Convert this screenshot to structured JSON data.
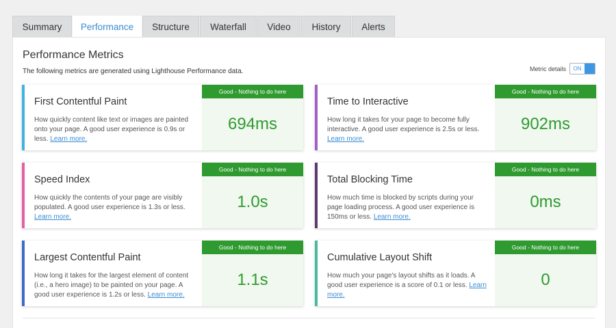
{
  "tabs": [
    {
      "label": "Summary",
      "active": false
    },
    {
      "label": "Performance",
      "active": true
    },
    {
      "label": "Structure",
      "active": false
    },
    {
      "label": "Waterfall",
      "active": false
    },
    {
      "label": "Video",
      "active": false
    },
    {
      "label": "History",
      "active": false
    },
    {
      "label": "Alerts",
      "active": false
    }
  ],
  "panel": {
    "title": "Performance Metrics",
    "description": "The following metrics are generated using Lighthouse Performance data.",
    "metric_details_label": "Metric details",
    "metric_details_state": "ON"
  },
  "colors": {
    "accent": "#3a8bd1",
    "good": "#2f9a2f",
    "good_bg": "#f0f8ef"
  },
  "metrics": [
    {
      "title": "First Contentful Paint",
      "description": "How quickly content like text or images are painted onto your page. A good user experience is 0.9s or less.",
      "learn_more": "Learn more.",
      "badge": "Good - Nothing to do here",
      "value": "694ms",
      "color": "#3fb5de"
    },
    {
      "title": "Time to Interactive",
      "description": "How long it takes for your page to become fully interactive. A good user experience is 2.5s or less.",
      "learn_more": "Learn more.",
      "badge": "Good - Nothing to do here",
      "value": "902ms",
      "color": "#a461c4"
    },
    {
      "title": "Speed Index",
      "description": "How quickly the contents of your page are visibly populated. A good user experience is 1.3s or less.",
      "learn_more": "Learn more.",
      "badge": "Good - Nothing to do here",
      "value": "1.0s",
      "color": "#e561a6"
    },
    {
      "title": "Total Blocking Time",
      "description": "How much time is blocked by scripts during your page loading process. A good user experience is 150ms or less.",
      "learn_more": "Learn more.",
      "badge": "Good - Nothing to do here",
      "value": "0ms",
      "color": "#5d3a72"
    },
    {
      "title": "Largest Contentful Paint",
      "description": "How long it takes for the largest element of content (i.e., a hero image) to be painted on your page. A good user experience is 1.2s or less.",
      "learn_more": "Learn more.",
      "badge": "Good - Nothing to do here",
      "value": "1.1s",
      "color": "#3c6cc7"
    },
    {
      "title": "Cumulative Layout Shift",
      "description": "How much your page's layout shifts as it loads. A good user experience is a score of 0.1 or less.",
      "learn_more": "Learn more.",
      "badge": "Good - Nothing to do here",
      "value": "0",
      "color": "#4ab9a1"
    }
  ]
}
